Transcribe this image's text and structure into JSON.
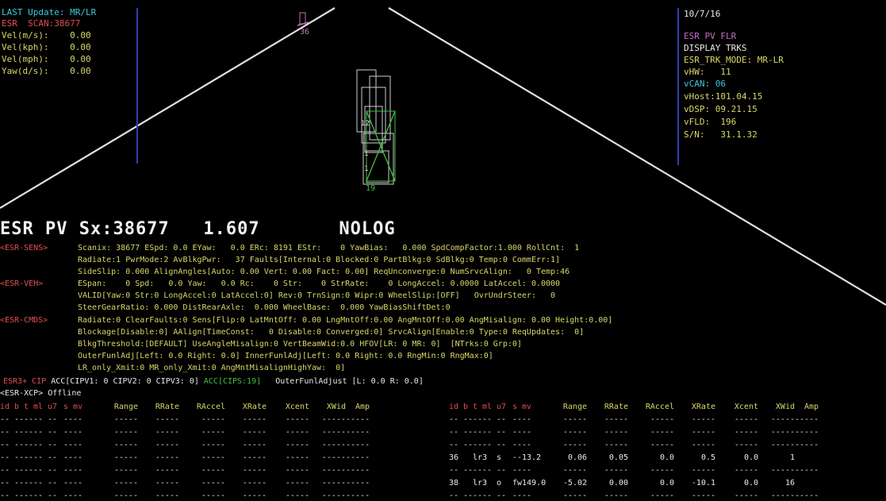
{
  "left_panel": {
    "last_update": "LAST Update: MR/LR",
    "scan": "ESR  SCAN:38677",
    "rows": [
      {
        "label": "Vel(m/s):",
        "value": "0.00"
      },
      {
        "label": "Vel(kph):",
        "value": "0.00"
      },
      {
        "label": "Vel(mph):",
        "value": "0.00"
      },
      {
        "label": "Yaw(d/s):",
        "value": "0.00"
      }
    ]
  },
  "right_panel": {
    "date": "10/7/16",
    "title": "ESR PV FLR",
    "display": "DISPLAY TRKS",
    "trk_mode": "ESR_TRK_MODE: MR-LR",
    "vhw": "vHW:   11",
    "vcan": "vCAN: 06",
    "vhost": "vHost:101.04.15",
    "vdsp": "vDSP: 09.21.15",
    "vfld": "vFLD:  196",
    "sn": "S/N:   31.1.32"
  },
  "scene": {
    "target_top_id": "36",
    "target_bottom_id": "19"
  },
  "status": {
    "main": "ESR PV Sx:38677   1.607       NOLOG"
  },
  "diagnostics": [
    {
      "label": "<ESR-SENS>",
      "lines": [
        "Scanix: 38677 ESpd: 0.0 EYaw:   0.0 ERc: 8191 EStr:    0 YawBias:   0.000 SpdCompFactor:1.000 RollCnt:  1",
        "Radiate:1 PwrMode:2 AvBlkgPwr:   37 Faults[Internal:0 Blocked:0 PartBlkg:0 SdBlkg:0 Temp:0 CommErr:1]",
        "SideSlip: 0.000 AlignAngles[Auto: 0.00 Vert: 0.00 Fact: 0.00] ReqUnconverge:0 NumSrvcAlign:   0 Temp:46"
      ]
    },
    {
      "label": "<ESR-VEH>",
      "lines": [
        "ESpan:    0 Spd:   0.0 Yaw:   0.0 Rc:    0 Str:    0 StrRate:    0 LongAccel: 0.0000 LatAccel: 0.0000",
        "VALID[Yaw:0 Str:0 LongAccel:0 LatAccel:0] Rev:0 TrnSign:0 Wipr:0 WheelSlip:[OFF]   OvrUndrSteer:   0",
        "SteerGearRatio: 0.000 DistRearAxle:  0.000 WheelBase:  0.000 YawBiasShiftDet:0"
      ]
    },
    {
      "label": "<ESR-CMDS>",
      "lines": [
        "Radiate:0 ClearFaults:0 Sens[Flip:0 LatMntOff: 0.00 LngMntOff:0.00 AngMntOff:0.00 AngMisalign: 0.00 Height:0.00]",
        "Blockage[Disable:0] AAlign[TimeConst:   0 Disable:0 Converged:0] SrvcAlign[Enable:0 Type:0 ReqUpdates:  0]",
        "BlkgThreshold:[DEFAULT] UseAngleMisalign:0 VertBeamWid:0.0 HFOV[LR: 0 MR: 0]  [NTrks:0 Grp:0]",
        "OuterFunlAdj[Left: 0.0 Right: 0.0] InnerFunlAdj[Left: 0.0 Right: 0.0 RngMin:0 RngMax:0]",
        "LR_only_Xmit:0 MR_only_Xmit:0 AngMntMisalignHighYaw:  0]"
      ]
    }
  ],
  "acc_line": {
    "esr_cip_label": "ESR3+ CIP",
    "acc_values": "ACC[CIPV1: 0 CIPV2: 0 CIPV3: 0]",
    "acc_cips": "ACC[CIPS:19]",
    "outer_funl": "OuterFunlAdjust [L: 0.0 R: 0.0]"
  },
  "xcp_line": {
    "label": "<ESR-XCP>",
    "status": "Offline"
  },
  "track_table": {
    "headers_left": [
      "id",
      "b",
      "t",
      "ml",
      "u7",
      "s",
      "mv",
      "Range",
      "RRate",
      "RAccel",
      "XRate",
      "Xcent",
      "XWid",
      "Amp"
    ],
    "headers_right": [
      "id",
      "b",
      "t",
      "ml",
      "u7",
      "s",
      "mv",
      "Range",
      "RRate",
      "RAccel",
      "XRate",
      "Xcent",
      "XWid",
      "Amp"
    ],
    "right_rows": [
      [
        "36",
        "",
        "lr",
        "3",
        "s",
        "--",
        "13.2",
        "0.06",
        "0.05",
        "0.0",
        "0.5",
        "0.0",
        "1"
      ],
      [
        "38",
        "",
        "lr",
        "3",
        "o",
        "fw",
        "149.0",
        "-5.02",
        "0.00",
        "0.0",
        "-10.1",
        "0.0",
        "16"
      ]
    ]
  }
}
